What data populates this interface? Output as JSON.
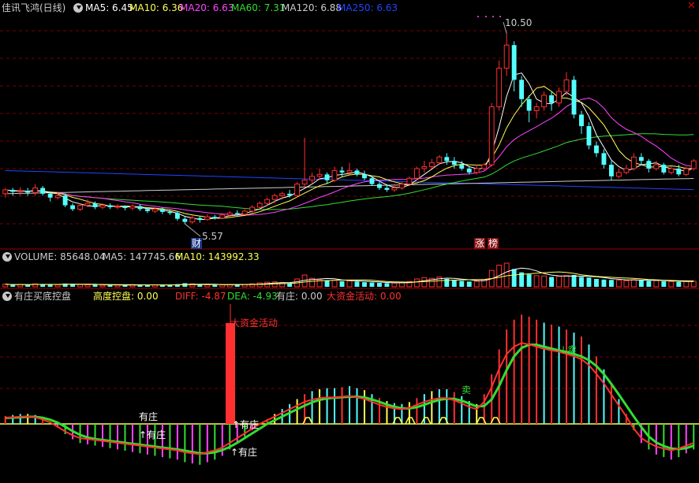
{
  "colors": {
    "up": "#ff3030",
    "down": "#54ffff",
    "ma5": "#ffffff",
    "ma10": "#ffff55",
    "ma20": "#ff44ff",
    "ma60": "#33dd33",
    "ma120": "#cccccc",
    "ma250": "#2244ff",
    "grid": "#7a0000",
    "text": "#cccccc"
  },
  "header": {
    "title": "佳讯飞鸿(日线)",
    "ma5": "MA5: 6.45",
    "ma10": "MA10: 6.36",
    "ma20": "MA20: 6.63",
    "ma60": "MA60: 7.31",
    "ma120": "MA120: 6.88",
    "ma250": "MA250: 6.63"
  },
  "price_marks": {
    "high": "10.50",
    "low": "5.57",
    "cai": "财",
    "zhang": "涨",
    "bang": "榜"
  },
  "volume_header": {
    "volume": "VOLUME: 85648.04",
    "ma5": "MA5: 147745.66",
    "ma10": "MA10: 143992.33"
  },
  "indicator_header": {
    "name": "有庄买底控盘",
    "gaodu": "高度控盘: 0.00",
    "diff": "DIFF: -4.87",
    "dea": "DEA: -4.93",
    "youzhuang": "有庄: 0.00",
    "dazijin": "大资金活动: 0.00"
  },
  "indicator_marks": {
    "dazijin": "大资金活动",
    "youzhuang_a": "有庄",
    "youzhuang_b": "↑有庄",
    "youzhuang_c": "↑有庄",
    "youzhuang_d": "↑有庄",
    "mai": "↓卖",
    "mai2": "卖"
  },
  "chart_data": [
    {
      "type": "candlestick",
      "title": "佳讯飞鸿(日线)",
      "ylim": [
        5.0,
        11.0
      ],
      "annotations": [
        {
          "label": "10.50",
          "value": 10.5
        },
        {
          "label": "5.57",
          "value": 5.57
        }
      ],
      "candles": [
        [
          6.35,
          6.45,
          6.25,
          6.5
        ],
        [
          6.45,
          6.4,
          6.3,
          6.5
        ],
        [
          6.4,
          6.42,
          6.3,
          6.52
        ],
        [
          6.42,
          6.38,
          6.3,
          6.5
        ],
        [
          6.38,
          6.5,
          6.3,
          6.6
        ],
        [
          6.5,
          6.35,
          6.3,
          6.55
        ],
        [
          6.35,
          6.25,
          6.15,
          6.4
        ],
        [
          6.25,
          6.3,
          6.2,
          6.4
        ],
        [
          6.3,
          6.05,
          6.0,
          6.35
        ],
        [
          6.05,
          5.95,
          5.9,
          6.1
        ],
        [
          5.95,
          6.05,
          5.9,
          6.1
        ],
        [
          6.05,
          6.1,
          6.0,
          6.2
        ],
        [
          6.1,
          6.0,
          5.95,
          6.15
        ],
        [
          6.0,
          6.05,
          5.95,
          6.1
        ],
        [
          6.05,
          6.0,
          5.95,
          6.1
        ],
        [
          6.0,
          6.02,
          5.95,
          6.08
        ],
        [
          6.02,
          5.98,
          5.92,
          6.05
        ],
        [
          5.98,
          6.03,
          5.92,
          6.08
        ],
        [
          6.03,
          5.95,
          5.9,
          6.08
        ],
        [
          5.95,
          5.9,
          5.85,
          6.0
        ],
        [
          5.9,
          5.95,
          5.85,
          6.0
        ],
        [
          5.95,
          5.88,
          5.82,
          6.0
        ],
        [
          5.88,
          5.85,
          5.8,
          5.92
        ],
        [
          5.85,
          5.7,
          5.65,
          5.9
        ],
        [
          5.7,
          5.62,
          5.57,
          5.75
        ],
        [
          5.62,
          5.72,
          5.57,
          5.78
        ],
        [
          5.72,
          5.68,
          5.6,
          5.78
        ],
        [
          5.68,
          5.75,
          5.65,
          5.82
        ],
        [
          5.75,
          5.72,
          5.68,
          5.8
        ],
        [
          5.72,
          5.8,
          5.7,
          5.85
        ],
        [
          5.8,
          5.85,
          5.75,
          5.9
        ],
        [
          5.85,
          5.82,
          5.78,
          5.92
        ],
        [
          5.82,
          5.9,
          5.8,
          5.95
        ],
        [
          5.9,
          6.0,
          5.85,
          6.05
        ],
        [
          6.0,
          6.1,
          5.95,
          6.15
        ],
        [
          6.1,
          6.2,
          6.05,
          6.25
        ],
        [
          6.2,
          6.3,
          6.1,
          6.35
        ],
        [
          6.3,
          6.35,
          6.2,
          6.4
        ],
        [
          6.35,
          6.3,
          6.25,
          6.45
        ],
        [
          6.3,
          6.6,
          6.25,
          6.65
        ],
        [
          6.6,
          6.7,
          6.5,
          7.8
        ],
        [
          6.7,
          6.8,
          6.6,
          6.9
        ],
        [
          6.8,
          6.85,
          6.7,
          7.0
        ],
        [
          6.85,
          6.7,
          6.6,
          6.9
        ],
        [
          6.7,
          6.95,
          6.65,
          7.05
        ],
        [
          6.95,
          6.9,
          6.8,
          7.05
        ],
        [
          6.9,
          6.95,
          6.85,
          7.15
        ],
        [
          6.95,
          6.85,
          6.8,
          7.0
        ],
        [
          6.85,
          6.75,
          6.7,
          6.95
        ],
        [
          6.75,
          6.6,
          6.55,
          6.8
        ],
        [
          6.6,
          6.5,
          6.45,
          6.65
        ],
        [
          6.5,
          6.45,
          6.4,
          6.6
        ],
        [
          6.45,
          6.5,
          6.4,
          6.6
        ],
        [
          6.5,
          6.6,
          6.45,
          6.65
        ],
        [
          6.6,
          6.75,
          6.55,
          6.8
        ],
        [
          6.75,
          7.0,
          6.7,
          7.05
        ],
        [
          7.0,
          7.05,
          6.9,
          7.2
        ],
        [
          7.05,
          7.15,
          7.0,
          7.25
        ],
        [
          7.15,
          7.3,
          7.1,
          7.35
        ],
        [
          7.3,
          7.2,
          7.1,
          7.4
        ],
        [
          7.2,
          7.1,
          7.0,
          7.3
        ],
        [
          7.1,
          7.0,
          6.95,
          7.2
        ],
        [
          7.0,
          6.9,
          6.85,
          7.05
        ],
        [
          6.9,
          7.0,
          6.85,
          7.1
        ],
        [
          7.0,
          7.1,
          6.95,
          7.15
        ],
        [
          7.1,
          8.6,
          7.05,
          8.7
        ],
        [
          8.6,
          9.6,
          8.5,
          9.8
        ],
        [
          9.6,
          10.2,
          9.4,
          10.5
        ],
        [
          10.2,
          9.3,
          9.0,
          10.3
        ],
        [
          9.3,
          8.8,
          8.6,
          9.4
        ],
        [
          8.8,
          8.5,
          8.2,
          8.9
        ],
        [
          8.5,
          8.6,
          8.3,
          8.7
        ],
        [
          8.6,
          8.9,
          8.5,
          9.0
        ],
        [
          8.9,
          8.7,
          8.5,
          9.0
        ],
        [
          8.7,
          9.0,
          8.6,
          9.1
        ],
        [
          9.0,
          9.3,
          8.9,
          9.5
        ],
        [
          9.3,
          8.4,
          8.3,
          9.4
        ],
        [
          8.4,
          8.1,
          7.9,
          8.5
        ],
        [
          8.1,
          7.6,
          7.5,
          8.2
        ],
        [
          7.6,
          7.4,
          7.3,
          7.7
        ],
        [
          7.4,
          7.1,
          7.0,
          7.5
        ],
        [
          7.1,
          6.8,
          6.7,
          7.2
        ],
        [
          6.8,
          6.9,
          6.75,
          7.0
        ],
        [
          6.9,
          7.0,
          6.85,
          7.1
        ],
        [
          7.0,
          7.3,
          6.95,
          7.4
        ],
        [
          7.3,
          7.2,
          7.1,
          7.4
        ],
        [
          7.2,
          7.0,
          6.9,
          7.25
        ],
        [
          7.0,
          7.1,
          6.95,
          7.2
        ],
        [
          7.1,
          6.9,
          6.85,
          7.15
        ],
        [
          6.9,
          7.0,
          6.85,
          7.05
        ],
        [
          7.0,
          6.85,
          6.8,
          7.1
        ],
        [
          6.85,
          7.0,
          6.8,
          7.05
        ],
        [
          7.0,
          7.2,
          6.95,
          7.25
        ]
      ]
    },
    {
      "type": "bar",
      "title": "VOLUME",
      "ylim": [
        0,
        380000
      ],
      "values": [
        40,
        30,
        35,
        30,
        45,
        40,
        35,
        30,
        50,
        45,
        35,
        30,
        30,
        25,
        30,
        28,
        25,
        30,
        28,
        35,
        30,
        28,
        25,
        40,
        55,
        45,
        35,
        30,
        28,
        30,
        35,
        32,
        35,
        45,
        60,
        70,
        75,
        65,
        55,
        120,
        180,
        130,
        110,
        95,
        100,
        85,
        90,
        80,
        70,
        65,
        60,
        55,
        58,
        65,
        80,
        120,
        140,
        130,
        150,
        120,
        100,
        90,
        80,
        85,
        110,
        250,
        330,
        360,
        270,
        220,
        190,
        170,
        165,
        150,
        160,
        170,
        180,
        150,
        140,
        120,
        110,
        105,
        100,
        95,
        110,
        100,
        90,
        95,
        85,
        80,
        75,
        80,
        85
      ]
    },
    {
      "type": "bar",
      "title": "有庄买底控盘",
      "ylim": [
        -6,
        15
      ],
      "series": [
        {
          "name": "DIFF",
          "values": [
            0.8,
            0.9,
            1.0,
            1.0,
            0.9,
            0.6,
            0.2,
            -0.3,
            -0.8,
            -1.2,
            -1.5,
            -1.6,
            -1.7,
            -1.8,
            -1.9,
            -2.0,
            -2.1,
            -2.2,
            -2.3,
            -2.4,
            -2.5,
            -2.6,
            -2.7,
            -2.8,
            -3.0,
            -3.1,
            -3.2,
            -3.0,
            -2.8,
            -2.5,
            -2.0,
            -1.5,
            -1.0,
            -0.5,
            0.0,
            0.5,
            1.0,
            1.5,
            2.0,
            2.5,
            3.0,
            3.3,
            3.5,
            3.6,
            3.6,
            3.7,
            3.8,
            3.6,
            3.4,
            3.0,
            2.6,
            2.3,
            2.1,
            2.0,
            2.2,
            2.6,
            3.0,
            3.3,
            3.5,
            3.5,
            3.2,
            2.8,
            2.3,
            2.0,
            3.0,
            5.0,
            7.5,
            9.5,
            10.5,
            11.0,
            10.8,
            10.5,
            10.2,
            10.0,
            9.8,
            9.5,
            9.2,
            8.8,
            8.0,
            6.8,
            5.5,
            4.0,
            2.5,
            1.0,
            -0.5,
            -1.5,
            -2.0,
            -2.4,
            -2.6,
            -2.8,
            -2.6,
            -2.3,
            -2.0
          ]
        }
      ]
    }
  ]
}
